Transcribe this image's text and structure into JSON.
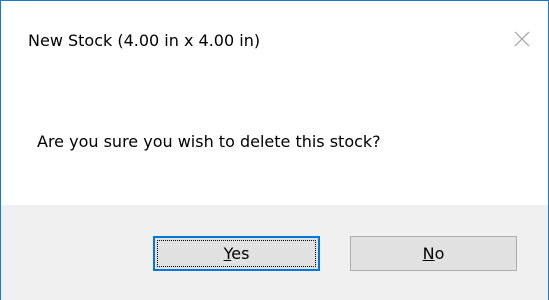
{
  "window": {
    "title": "New Stock (4.00 in x 4.00 in)",
    "close_icon": "close-icon",
    "accent_color": "#1979ca"
  },
  "message": "Are you sure you wish to delete this stock?",
  "buttons": {
    "yes": {
      "accel": "Y",
      "rest": "es",
      "is_default": true
    },
    "no": {
      "accel": "N",
      "rest": "o",
      "is_default": false
    }
  }
}
